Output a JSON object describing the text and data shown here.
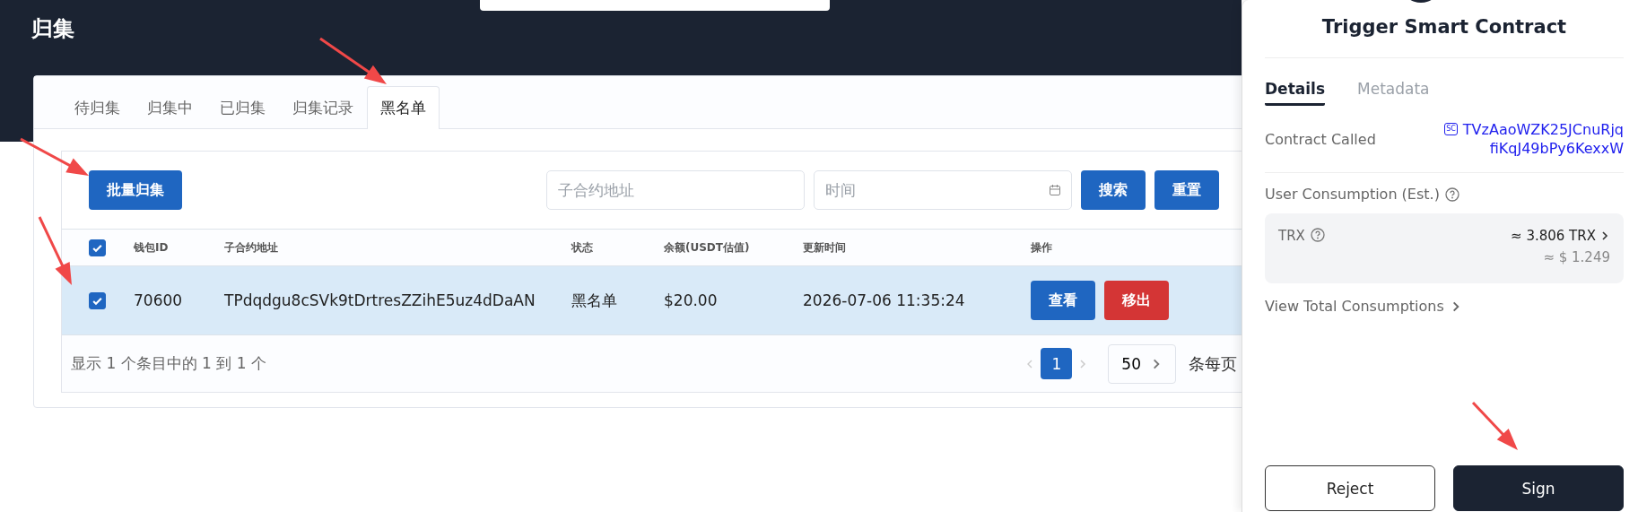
{
  "page": {
    "title": "归集"
  },
  "tabs": [
    {
      "label": "待归集",
      "selected": false
    },
    {
      "label": "归集中",
      "selected": false
    },
    {
      "label": "已归集",
      "selected": false
    },
    {
      "label": "归集记录",
      "selected": false
    },
    {
      "label": "黑名单",
      "selected": true
    }
  ],
  "toolbar": {
    "batch_button": "批量归集",
    "address_field": {
      "placeholder": "子合约地址"
    },
    "time_field": {
      "placeholder": "时间"
    },
    "search_button": "搜索",
    "reset_button": "重置"
  },
  "table": {
    "select_all_checked": true,
    "columns": [
      "钱包ID",
      "子合约地址",
      "状态",
      "余额(USDT估值)",
      "更新时间",
      "操作"
    ],
    "rows": [
      {
        "checked": true,
        "selected": true,
        "wallet_id": "70600",
        "address": "TPdqdgu8cSVk9tDrtresZZihE5uz4dDaAN",
        "status": "黑名单",
        "balance": "$20.00",
        "updated": "2026-07-06 11:35:24",
        "actions": [
          {
            "label": "查看",
            "kind": "primary"
          },
          {
            "label": "移出",
            "kind": "danger"
          }
        ]
      }
    ]
  },
  "footer": {
    "summary": "显示 1 个条目中的 1 到 1 个",
    "pages": [
      {
        "label": "1",
        "selected": true
      }
    ],
    "page_size": "50",
    "page_size_suffix": "条每页"
  },
  "wallet": {
    "title": "Trigger Smart Contract",
    "tabs": [
      {
        "label": "Details",
        "selected": true
      },
      {
        "label": "Metadata",
        "selected": false
      }
    ],
    "contract_label": "Contract Called",
    "contract_badge": "SC",
    "contract_address_lines": [
      "TVzAaoWZK25JCnuRjq",
      "fiKqJ49bPy6KexxW"
    ],
    "consumption_label": "User Consumption (Est.)",
    "fee": {
      "token": "TRX",
      "amount": "≈ 3.806 TRX",
      "usd": "≈ $ 1.249"
    },
    "view_total": "View Total Consumptions",
    "buttons": [
      {
        "label": "Reject",
        "kind": "secondary"
      },
      {
        "label": "Sign",
        "kind": "primary"
      }
    ]
  }
}
